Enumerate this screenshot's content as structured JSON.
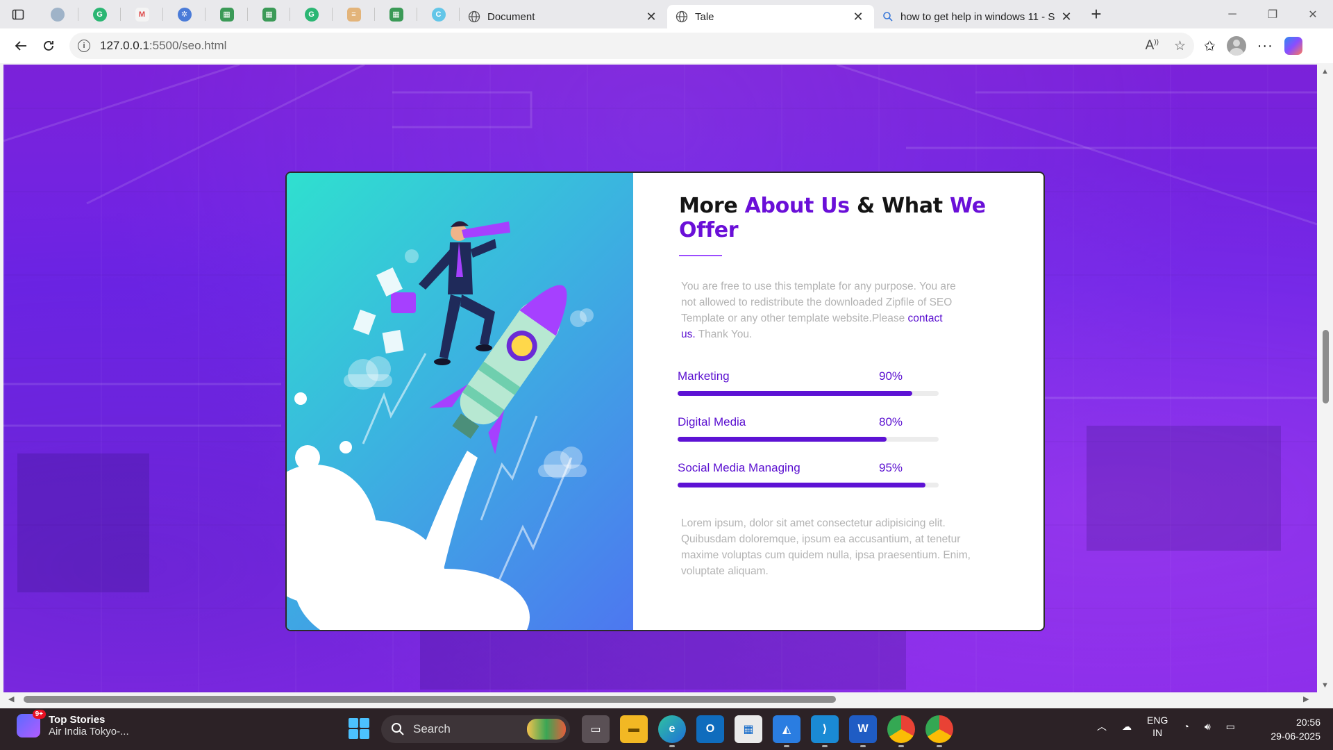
{
  "browser": {
    "tabs": [
      {
        "title": "Document",
        "active": false
      },
      {
        "title": "Tale",
        "active": true
      },
      {
        "title": "how to get help in windows 11 - S",
        "active": false
      }
    ],
    "url_host": "127.0.0.1",
    "url_path": ":5500/seo.html"
  },
  "page": {
    "heading_part1": "More ",
    "heading_accent1": "About Us",
    "heading_part2": " & What ",
    "heading_accent2": "We Offer",
    "intro_text": "You are free to use this template for any purpose. You are not allowed to redistribute the downloaded Zipfile of SEO Template or any other template website.Please",
    "intro_link": "contact us.",
    "intro_tail": " Thank You.",
    "skills": [
      {
        "name": "Marketing",
        "percent_label": "90%",
        "value": 0.9
      },
      {
        "name": "Digital Media",
        "percent_label": "80%",
        "value": 0.8
      },
      {
        "name": "Social Media Managing",
        "percent_label": "95%",
        "value": 0.95
      }
    ],
    "outro_text": "Lorem ipsum, dolor sit amet consectetur adipisicing elit. Quibusdam doloremque, ipsum ea accusantium, at tenetur maxime voluptas cum quidem nulla, ipsa praesentium. Enim, voluptate aliquam."
  },
  "taskbar": {
    "news_title": "Top Stories",
    "news_sub": "Air India Tokyo-...",
    "news_badge": "9+",
    "search_placeholder": "Search",
    "lang_line1": "ENG",
    "lang_line2": "IN",
    "time": "20:56",
    "date": "29-06-2025"
  },
  "colors": {
    "accent": "#6a0fd8",
    "bar": "#5d12d4",
    "background": "#7b22d9"
  }
}
